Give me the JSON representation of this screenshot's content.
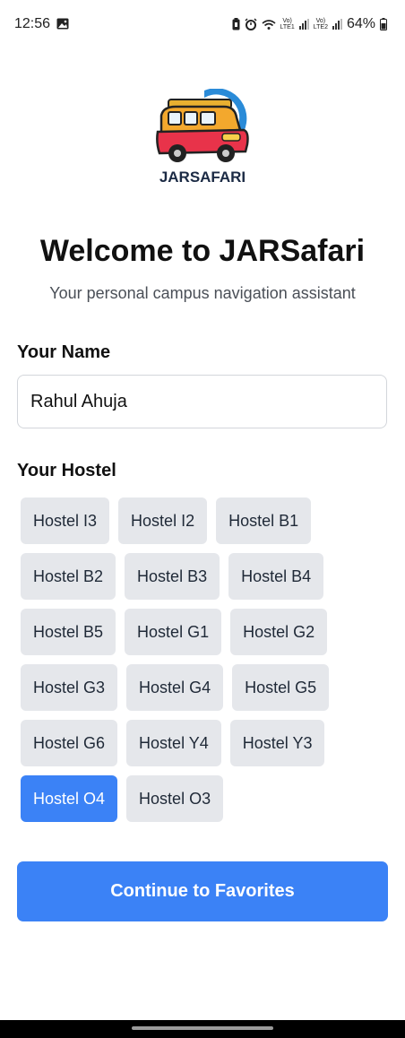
{
  "status_bar": {
    "time": "12:56",
    "sim1": "Vo)\nLTE1",
    "sim2": "Vo)\nLTE2",
    "battery": "64%",
    "icons": [
      "image-icon",
      "battery-saver-icon",
      "alarm-icon",
      "wifi-icon",
      "signal-icon",
      "battery-icon"
    ]
  },
  "logo": {
    "text": "JARSAFARI"
  },
  "header": {
    "title": "Welcome to JARSafari",
    "subtitle": "Your personal campus navigation assistant"
  },
  "name_field": {
    "label": "Your Name",
    "value": "Rahul Ahuja"
  },
  "hostel_field": {
    "label": "Your Hostel",
    "options": [
      {
        "label": "Hostel I3",
        "selected": false
      },
      {
        "label": "Hostel I2",
        "selected": false
      },
      {
        "label": "Hostel B1",
        "selected": false
      },
      {
        "label": "Hostel B2",
        "selected": false
      },
      {
        "label": "Hostel B3",
        "selected": false
      },
      {
        "label": "Hostel B4",
        "selected": false
      },
      {
        "label": "Hostel B5",
        "selected": false
      },
      {
        "label": "Hostel G1",
        "selected": false
      },
      {
        "label": "Hostel G2",
        "selected": false
      },
      {
        "label": "Hostel G3",
        "selected": false
      },
      {
        "label": "Hostel G4",
        "selected": false
      },
      {
        "label": "Hostel G5",
        "selected": false
      },
      {
        "label": "Hostel G6",
        "selected": false
      },
      {
        "label": "Hostel Y4",
        "selected": false
      },
      {
        "label": "Hostel Y3",
        "selected": false
      },
      {
        "label": "Hostel O4",
        "selected": true
      },
      {
        "label": "Hostel O3",
        "selected": false
      }
    ]
  },
  "continue_button": {
    "label": "Continue to Favorites"
  },
  "colors": {
    "accent": "#3b82f6",
    "chip_bg": "#e5e7eb",
    "text": "#111111"
  }
}
